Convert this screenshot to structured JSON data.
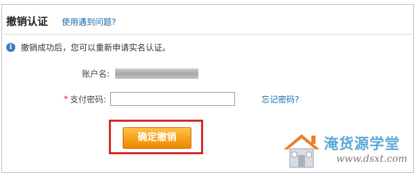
{
  "header": {
    "title": "撤销认证",
    "help_link": "使用遇到问题?"
  },
  "notice": {
    "icon": "info-icon",
    "text": "撤销成功后，您可以重新申请实名认证。"
  },
  "form": {
    "account_label": "账户名:",
    "password_required_mark": "*",
    "password_label": "支付密码:",
    "password_value": "",
    "forgot_link": "忘记密码?",
    "confirm_button": "确定撤销"
  },
  "watermark": {
    "text": "淹货源学堂",
    "url": "www.dsxt.com"
  },
  "colors": {
    "link": "#1a6aa8",
    "button": "#f7a21b",
    "highlight": "#d32a2a",
    "required": "#d11a1a"
  }
}
